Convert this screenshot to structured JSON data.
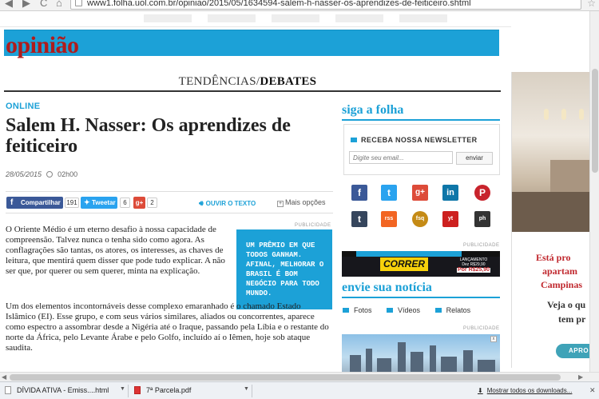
{
  "browser": {
    "url": "www1.folha.uol.com.br/opiniao/2015/05/1634594-salem-h-nasser-os-aprendizes-de-feiticeiro.shtml"
  },
  "colors": {
    "folha_blue": "#1ca1d7",
    "opiniao_red": "#b01b1b",
    "facebook": "#3b5998",
    "twitter": "#2aa3ef",
    "google_plus": "#dd4b39"
  },
  "header": {
    "section": "opinião",
    "subsection_prefix": "TENDÊNCIAS/",
    "subsection_bold": "DEBATES"
  },
  "article": {
    "kicker": "ONLINE",
    "title": "Salem H. Nasser: Os aprendizes de feiticeiro",
    "date": "28/05/2015",
    "time": "02h00",
    "share": {
      "facebook_label": "Compartilhar",
      "facebook_count": "191",
      "twitter_label": "Tweetar",
      "twitter_count": "6",
      "gplus_label": "g+",
      "gplus_count": "2",
      "listen_label": "OUVIR O TEXTO",
      "more_label": "Mais opções"
    },
    "publicidade": "PUBLICIDADE",
    "paragraphs": [
      "O Oriente Médio é um eterno desafio à nossa capacidade de compreensão. Talvez nunca o tenha sido como agora. As conflagrações são tantas, os atores, os interesses, as chaves de leitura, que mentirá quem disser que pode tudo explicar. A não ser que, por querer ou sem querer, minta na explicação.",
      "Um dos elementos incontornáveis desse complexo emaranhado é o chamado Estado Islâmico (EI). Esse grupo, e com seus vários similares, aliados ou concorrentes, aparece como espectro a assombrar desde a Nigéria até o Iraque, passando pela Líbia e o restante do norte da África, pelo Levante Árabe e pelo Golfo, incluído aí o Iêmen, hoje sob ataque saudita."
    ],
    "promo": "Um prêmio em que todos ganham. Afinal, melhorar o Brasil é bom negócio para todo mundo."
  },
  "sidebar": {
    "siga": "siga a folha",
    "newsletter_title": "RECEBA NOSSA NEWSLETTER",
    "email_placeholder": "Digite seu email...",
    "send_label": "enviar",
    "social": [
      "f",
      "t",
      "g+",
      "in",
      "P",
      "t",
      "rss",
      "fsq",
      "yt",
      "ph"
    ],
    "publicidade": "PUBLICIDADE",
    "ad_correr": {
      "word": "CORRER",
      "tag": "LANÇAMENTO",
      "price_small": "Dez R$29,90",
      "price": "Por R$25,90"
    },
    "envie": "envie sua notícia",
    "envie_items": [
      "Fotos",
      "Vídeos",
      "Relatos"
    ]
  },
  "right_ad": {
    "line1": "Está pro",
    "line2": "apartam",
    "line3": "Campinas",
    "line4": "Veja o qu",
    "line5": "tem pr",
    "button": "APRO"
  },
  "downloads": {
    "items": [
      {
        "name": "DÍVIDA ATIVA - Emiss....html"
      },
      {
        "name": "7ª Parcela.pdf"
      }
    ],
    "show_all": "Mostrar todos os downloads..."
  }
}
